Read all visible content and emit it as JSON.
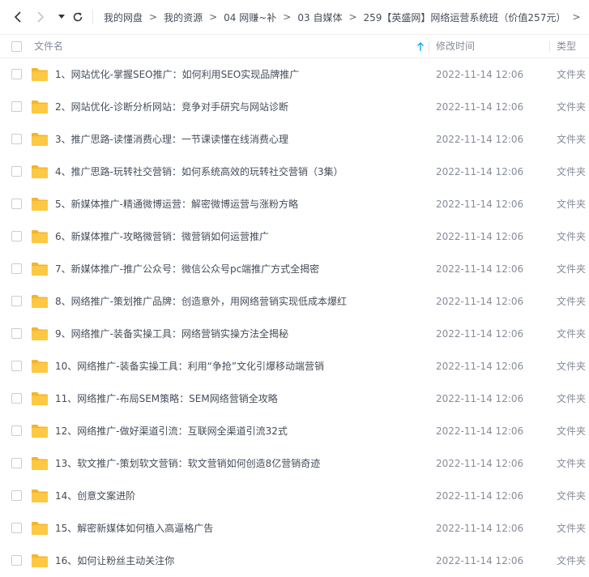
{
  "toolbar": {
    "breadcrumb": [
      "我的网盘",
      "我的资源",
      "04 网赚~补",
      "03 自媒体",
      "259【英盛网】网络运营系统班（价值257元）"
    ],
    "separator": ">"
  },
  "header": {
    "name_label": "文件名",
    "time_label": "修改时间",
    "type_label": "类型"
  },
  "files": [
    {
      "name": "1、网站优化-掌握SEO推广：如何利用SEO实现品牌推广",
      "modified": "2022-11-14 12:06",
      "type": "文件夹"
    },
    {
      "name": "2、网站优化-诊断分析网站：竞争对手研究与网站诊断",
      "modified": "2022-11-14 12:06",
      "type": "文件夹"
    },
    {
      "name": "3、推广思路-读懂消费心理：一节课读懂在线消费心理",
      "modified": "2022-11-14 12:06",
      "type": "文件夹"
    },
    {
      "name": "4、推广思路-玩转社交营销：如何系统高效的玩转社交营销（3集）",
      "modified": "2022-11-14 12:06",
      "type": "文件夹"
    },
    {
      "name": "5、新媒体推广-精通微博运营：解密微博运营与涨粉方略",
      "modified": "2022-11-14 12:06",
      "type": "文件夹"
    },
    {
      "name": "6、新媒体推广-攻略微营销：微营销如何运营推广",
      "modified": "2022-11-14 12:06",
      "type": "文件夹"
    },
    {
      "name": "7、新媒体推广-推广公众号：微信公众号pc端推广方式全揭密",
      "modified": "2022-11-14 12:06",
      "type": "文件夹"
    },
    {
      "name": "8、网络推广-策划推广品牌：创造意外，用网络营销实现低成本爆红",
      "modified": "2022-11-14 12:06",
      "type": "文件夹"
    },
    {
      "name": "9、网络推广-装备实操工具：网络营销实操方法全揭秘",
      "modified": "2022-11-14 12:06",
      "type": "文件夹"
    },
    {
      "name": "10、网络推广-装备实操工具：利用“争抢”文化引爆移动端营销",
      "modified": "2022-11-14 12:06",
      "type": "文件夹"
    },
    {
      "name": "11、网络推广-布局SEM策略：SEM网络营销全攻略",
      "modified": "2022-11-14 12:06",
      "type": "文件夹"
    },
    {
      "name": "12、网络推广-做好渠道引流：互联网全渠道引流32式",
      "modified": "2022-11-14 12:06",
      "type": "文件夹"
    },
    {
      "name": "13、软文推广-策划软文营销：软文营销如何创造8亿营销奇迹",
      "modified": "2022-11-14 12:06",
      "type": "文件夹"
    },
    {
      "name": "14、创意文案进阶",
      "modified": "2022-11-14 12:06",
      "type": "文件夹"
    },
    {
      "name": "15、解密新媒体如何植入高逼格广告",
      "modified": "2022-11-14 12:06",
      "type": "文件夹"
    },
    {
      "name": "16、如何让粉丝主动关注你",
      "modified": "2022-11-14 12:06",
      "type": "文件夹"
    }
  ],
  "colors": {
    "folder": "#fdc843",
    "folder_dark": "#f5b52a",
    "text": "#454d5a",
    "muted": "#878c9c",
    "accent": "#06a7ff"
  }
}
